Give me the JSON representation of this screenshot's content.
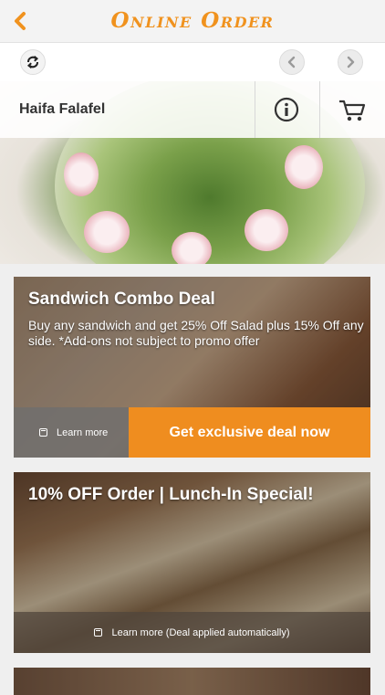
{
  "header": {
    "title": "Online Order",
    "back_label": "<"
  },
  "nav": {
    "refresh_icon": "refresh-icon",
    "prev_icon": "chevron-left-icon",
    "next_icon": "chevron-right-icon"
  },
  "restaurant": {
    "name": "Haifa Falafel",
    "info_icon": "info-icon",
    "cart_icon": "cart-icon"
  },
  "deals": [
    {
      "title": "Sandwich Combo Deal",
      "description": "Buy any sandwich and get 25% Off Salad plus 15% Off any side. *Add-ons not subject to promo offer",
      "learn_more": "Learn more",
      "cta": "Get exclusive deal now"
    },
    {
      "title": "10% OFF Order | Lunch-In Special!",
      "learn_more": "Learn more (Deal applied automatically)"
    }
  ],
  "colors": {
    "accent": "#ef8d1f",
    "title_orange": "#f0921e"
  }
}
